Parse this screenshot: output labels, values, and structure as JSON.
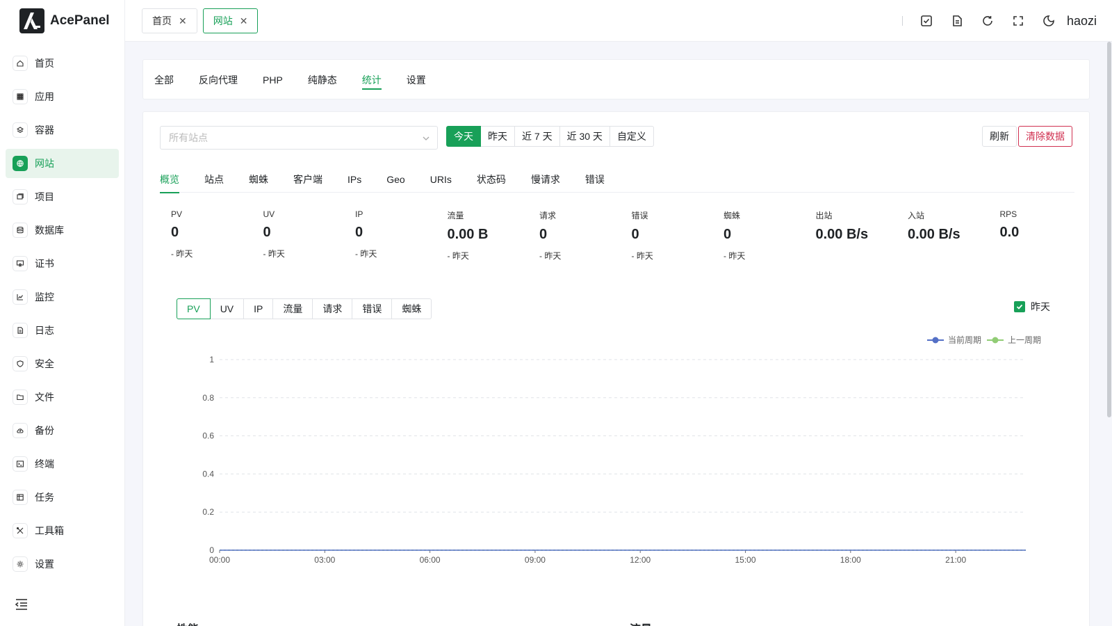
{
  "brand": {
    "name": "AcePanel"
  },
  "sidebar": {
    "items": [
      {
        "label": "首页",
        "icon": "home-icon"
      },
      {
        "label": "应用",
        "icon": "apps-icon"
      },
      {
        "label": "容器",
        "icon": "container-icon"
      },
      {
        "label": "网站",
        "icon": "globe-icon",
        "active": true
      },
      {
        "label": "项目",
        "icon": "project-icon"
      },
      {
        "label": "数据库",
        "icon": "database-icon"
      },
      {
        "label": "证书",
        "icon": "certificate-icon"
      },
      {
        "label": "监控",
        "icon": "chart-icon"
      },
      {
        "label": "日志",
        "icon": "log-icon"
      },
      {
        "label": "安全",
        "icon": "shield-icon"
      },
      {
        "label": "文件",
        "icon": "folder-icon"
      },
      {
        "label": "备份",
        "icon": "cloud-backup-icon"
      },
      {
        "label": "终端",
        "icon": "terminal-icon"
      },
      {
        "label": "任务",
        "icon": "task-icon"
      },
      {
        "label": "工具箱",
        "icon": "tools-icon"
      },
      {
        "label": "设置",
        "icon": "gear-icon"
      }
    ]
  },
  "header": {
    "tabs": [
      {
        "label": "首页",
        "active": false
      },
      {
        "label": "网站",
        "active": true
      }
    ],
    "username": "haozi"
  },
  "top_tabs": [
    "全部",
    "反向代理",
    "PHP",
    "纯静态",
    "统计",
    "设置"
  ],
  "top_tab_active": "统计",
  "filters": {
    "site_placeholder": "所有站点",
    "ranges": [
      "今天",
      "昨天",
      "近 7 天",
      "近 30 天",
      "自定义"
    ],
    "range_active": "今天",
    "refresh_label": "刷新",
    "clear_label": "清除数据"
  },
  "sub_tabs": [
    "概览",
    "站点",
    "蜘蛛",
    "客户端",
    "IPs",
    "Geo",
    "URIs",
    "状态码",
    "慢请求",
    "错误"
  ],
  "sub_tab_active": "概览",
  "stats": [
    {
      "label": "PV",
      "value": "0",
      "sub": "- 昨天"
    },
    {
      "label": "UV",
      "value": "0",
      "sub": "- 昨天"
    },
    {
      "label": "IP",
      "value": "0",
      "sub": "- 昨天"
    },
    {
      "label": "流量",
      "value": "0.00 B",
      "sub": "- 昨天"
    },
    {
      "label": "请求",
      "value": "0",
      "sub": "- 昨天"
    },
    {
      "label": "错误",
      "value": "0",
      "sub": "- 昨天"
    },
    {
      "label": "蜘蛛",
      "value": "0",
      "sub": "- 昨天"
    },
    {
      "label": "出站",
      "value": "0.00 B/s",
      "sub": ""
    },
    {
      "label": "入站",
      "value": "0.00 B/s",
      "sub": ""
    },
    {
      "label": "RPS",
      "value": "0.0",
      "sub": ""
    }
  ],
  "metrics": [
    "PV",
    "UV",
    "IP",
    "流量",
    "请求",
    "错误",
    "蜘蛛"
  ],
  "metric_active": "PV",
  "compare_label": "昨天",
  "sections": {
    "performance": "性能",
    "traffic": "流量"
  },
  "chart_data": {
    "type": "line",
    "x": [
      "00:00",
      "03:00",
      "06:00",
      "09:00",
      "12:00",
      "15:00",
      "18:00",
      "21:00"
    ],
    "yticks": [
      "0",
      "0.2",
      "0.4",
      "0.6",
      "0.8",
      "1"
    ],
    "ylim": [
      0,
      1
    ],
    "xlim": [
      0,
      23
    ],
    "grid": true,
    "legend_position": "top-right",
    "series": [
      {
        "name": "当前周期",
        "color": "#5470c6",
        "values": [
          0,
          0,
          0,
          0,
          0,
          0,
          0,
          0,
          0,
          0,
          0,
          0,
          0,
          0,
          0,
          0,
          0,
          0,
          0,
          0,
          0,
          0,
          0,
          0
        ]
      },
      {
        "name": "上一周期",
        "color": "#91cc75",
        "values": [
          0,
          0,
          0,
          0,
          0,
          0,
          0,
          0,
          0,
          0,
          0,
          0,
          0,
          0,
          0,
          0,
          0,
          0,
          0,
          0,
          0,
          0,
          0,
          0
        ]
      }
    ]
  },
  "colors": {
    "accent": "#18a058",
    "danger": "#d03050"
  }
}
